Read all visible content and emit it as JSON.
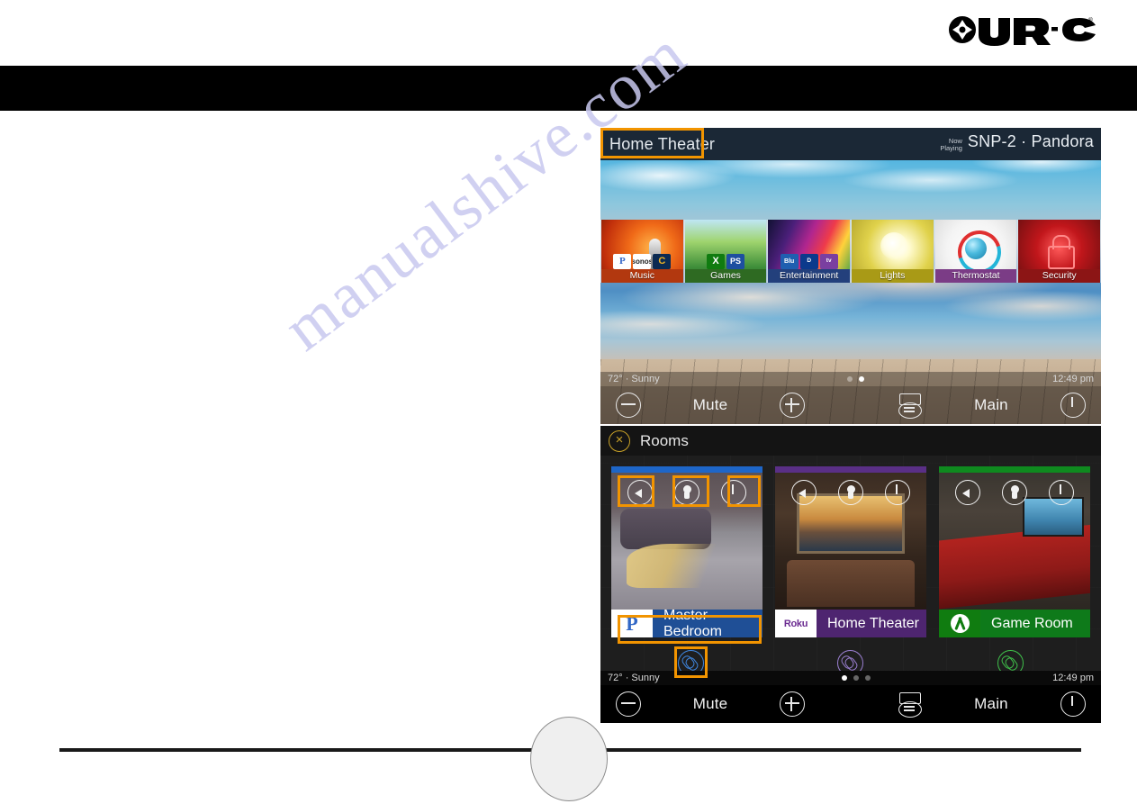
{
  "brand": {
    "name": "URC",
    "registered": "®"
  },
  "watermark": {
    "text": "manualshive.com"
  },
  "top_screen": {
    "room_title": "Home Theater",
    "now_playing": {
      "label_line1": "Now",
      "label_line2": "Playing",
      "value": "SNP-2 · Pandora"
    },
    "tiles": [
      {
        "label": "Music",
        "art": "art-music",
        "label_class": "lbl-music",
        "badges": [
          {
            "text": "P",
            "class": "bdg-pandora"
          },
          {
            "text": "sonos",
            "class": "bdg-sonos"
          },
          {
            "text": "C",
            "class": "bdg-sirius"
          }
        ]
      },
      {
        "label": "Games",
        "art": "art-games",
        "label_class": "lbl-games",
        "badges": [
          {
            "text": "X",
            "class": "bdg-xbox"
          },
          {
            "text": "PS",
            "class": "bdg-ps"
          }
        ]
      },
      {
        "label": "Entertainment",
        "art": "art-ent",
        "label_class": "lbl-ent",
        "badges": [
          {
            "text": "Blu",
            "class": "bdg-bluray"
          },
          {
            "text": "D",
            "class": "bdg-directv"
          },
          {
            "text": "tv",
            "class": "bdg-appletv"
          }
        ]
      },
      {
        "label": "Lights",
        "art": "art-lights",
        "label_class": "lbl-lights",
        "badges": []
      },
      {
        "label": "Thermostat",
        "art": "art-therm",
        "label_class": "lbl-therm",
        "badges": []
      },
      {
        "label": "Security",
        "art": "art-sec",
        "label_class": "lbl-sec",
        "badges": []
      }
    ],
    "status": {
      "weather": "72° · Sunny",
      "time": "12:49 pm",
      "page_count": 2,
      "page_active": 2
    },
    "controls": {
      "volume_down": "volume-minus-icon",
      "mute": "Mute",
      "volume_up": "volume-plus-icon",
      "device": "device-icon",
      "main": "Main",
      "power": "power-icon"
    }
  },
  "rooms_screen": {
    "close_label": "×",
    "title": "Rooms",
    "cards": [
      {
        "name": "Master Bedroom",
        "service": "P",
        "accent": "acc-blue",
        "label_class": "lab-blue",
        "logo_class": "svc-pandora",
        "photo_class": "photo-bed",
        "link_class": "lnk-blue"
      },
      {
        "name": "Home Theater",
        "service": "Roku",
        "accent": "acc-purple",
        "label_class": "lab-purple",
        "logo_class": "svc-roku",
        "photo_class": "photo-theater",
        "link_class": "lnk-purple"
      },
      {
        "name": "Game Room",
        "service": "",
        "accent": "acc-green",
        "label_class": "lab-green",
        "logo_class": "svc-xbox",
        "photo_class": "photo-game",
        "link_class": "lnk-green"
      }
    ],
    "card_icons": [
      "volume-icon",
      "lights-icon",
      "power-icon"
    ],
    "status": {
      "weather": "72° · Sunny",
      "time": "12:49 pm",
      "page_count": 3,
      "page_active": 1
    },
    "controls": {
      "volume_down": "volume-minus-icon",
      "mute": "Mute",
      "volume_up": "volume-plus-icon",
      "device": "device-icon",
      "main": "Main",
      "power": "power-icon"
    }
  },
  "highlights": {
    "color": "#f29400",
    "count": 6
  }
}
